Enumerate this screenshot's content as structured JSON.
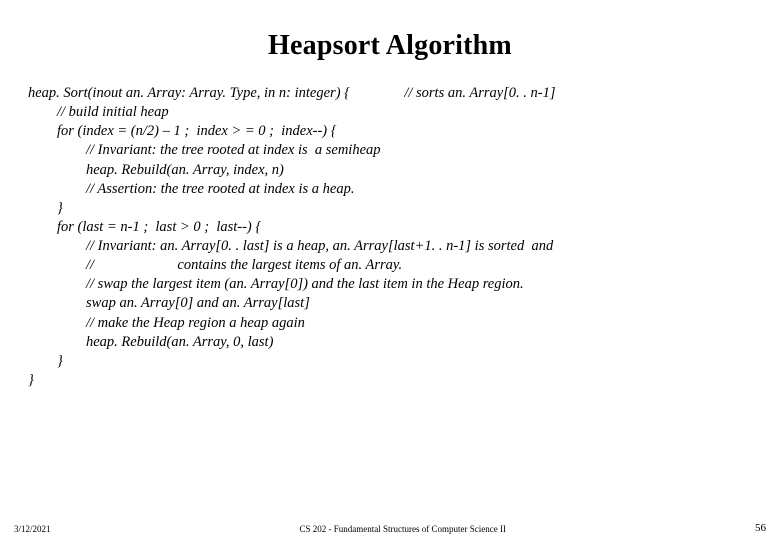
{
  "title": "Heapsort Algorithm",
  "code": {
    "l1a": "heap. Sort(inout an. Array: Array. Type, in n: integer) {",
    "l1b": "// sorts an. Array[0. . n-1]",
    "l2": "        // build initial heap",
    "l3": "        for (index = (n/2) – 1 ;  index > = 0 ;  index--) {",
    "l4": "                // Invariant: the tree rooted at index is  a semiheap",
    "l5": "                heap. Rebuild(an. Array, index, n)",
    "l6": "                // Assertion: the tree rooted at index is a heap.",
    "l7": "        }",
    "l8": "        for (last = n-1 ;  last > 0 ;  last--) {",
    "l9": "                // Invariant: an. Array[0. . last] is a heap, an. Array[last+1. . n-1] is sorted  and ",
    "l10": "                //                       contains the largest items of an. Array.",
    "l11": "                // swap the largest item (an. Array[0]) and the last item in the Heap region.",
    "l12": "                swap an. Array[0] and an. Array[last]",
    "l13": "                // make the Heap region a heap again",
    "l14": "                heap. Rebuild(an. Array, 0, last)",
    "l15": "        }",
    "l16": "}"
  },
  "footer": {
    "date": "3/12/2021",
    "course": "CS 202 - Fundamental Structures of Computer Science II",
    "page": "56"
  }
}
